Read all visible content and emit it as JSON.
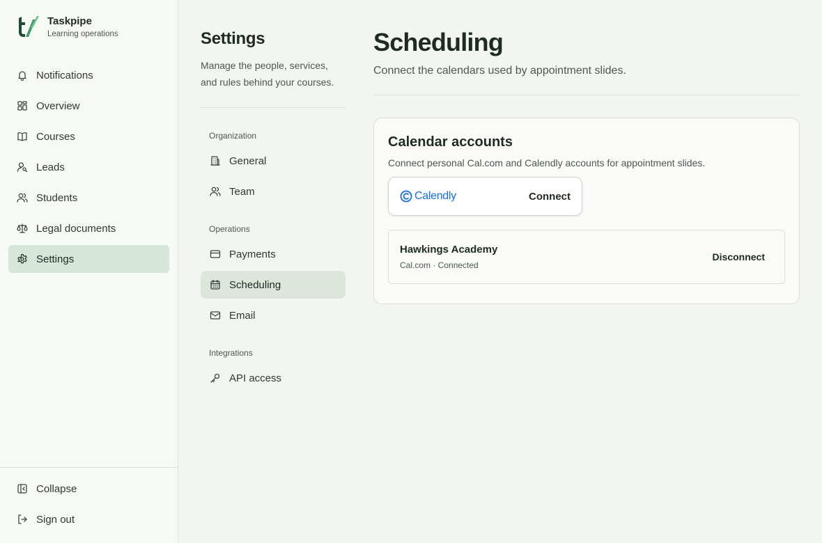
{
  "brand": {
    "name": "Taskpipe",
    "subtitle": "Learning operations"
  },
  "nav": {
    "items": [
      {
        "label": "Notifications",
        "icon": "bell-icon"
      },
      {
        "label": "Overview",
        "icon": "dashboard-icon"
      },
      {
        "label": "Courses",
        "icon": "book-icon"
      },
      {
        "label": "Leads",
        "icon": "user-search-icon"
      },
      {
        "label": "Students",
        "icon": "users-icon"
      },
      {
        "label": "Legal documents",
        "icon": "scale-icon"
      },
      {
        "label": "Settings",
        "icon": "gear-icon",
        "active": true
      }
    ],
    "collapse_label": "Collapse",
    "signout_label": "Sign out"
  },
  "settings": {
    "title": "Settings",
    "description": "Manage the people, services, and rules behind your courses.",
    "groups": [
      {
        "label": "Organization",
        "items": [
          {
            "label": "General",
            "icon": "building-icon"
          },
          {
            "label": "Team",
            "icon": "team-icon"
          }
        ]
      },
      {
        "label": "Operations",
        "items": [
          {
            "label": "Payments",
            "icon": "credit-card-icon"
          },
          {
            "label": "Scheduling",
            "icon": "calendar-icon",
            "active": true
          },
          {
            "label": "Email",
            "icon": "mail-icon"
          }
        ]
      },
      {
        "label": "Integrations",
        "items": [
          {
            "label": "API access",
            "icon": "key-icon"
          }
        ]
      }
    ]
  },
  "main": {
    "title": "Scheduling",
    "subtitle": "Connect the calendars used by appointment slides.",
    "card": {
      "title": "Calendar accounts",
      "description": "Connect personal Cal.com and Calendly accounts for appointment slides.",
      "provider": {
        "name": "Calendly",
        "action_label": "Connect"
      },
      "account": {
        "name": "Hawkings Academy",
        "meta": "Cal.com · Connected",
        "action_label": "Disconnect"
      }
    }
  },
  "colors": {
    "accent_active": "#d4e7d9",
    "calendly_blue": "#1a6fe0",
    "text_primary": "#1f2a24",
    "background": "#f3f5f0"
  }
}
